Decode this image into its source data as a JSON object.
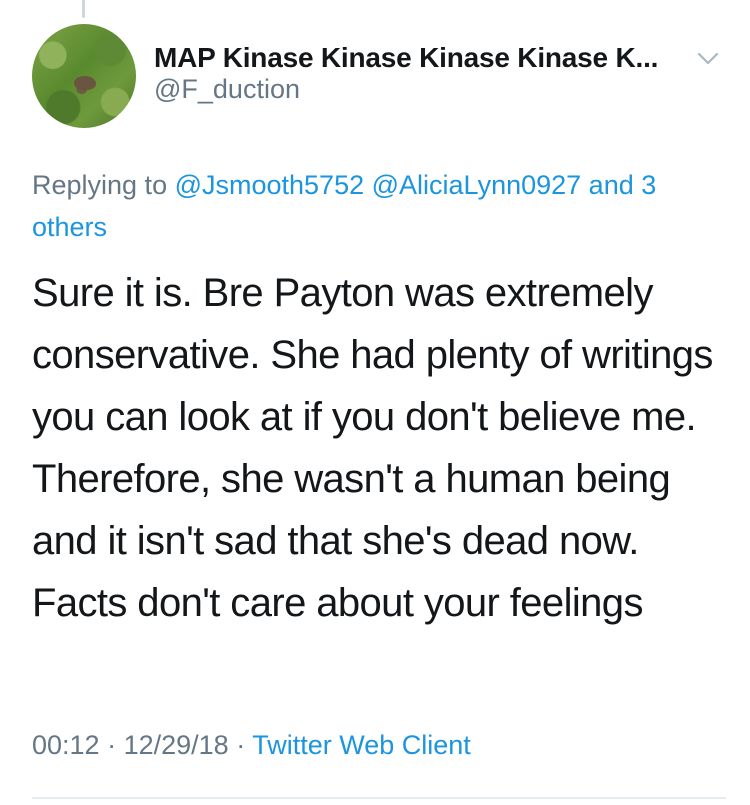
{
  "tweet": {
    "author": {
      "display_name": "MAP Kinase Kinase Kinase Kinase K...",
      "handle": "@F_duction",
      "avatar_icon": "avatar-photo-grass"
    },
    "reply_context": {
      "prefix": "Replying to ",
      "mentions": [
        "@Jsmooth5752",
        "@AliciaLynn0927"
      ],
      "suffix": " and 3 others"
    },
    "text": "Sure it is. Bre Payton was extremely conservative. She had plenty of writings you can look at if you don't believe me. Therefore, she wasn't a human being and it isn't sad that she's dead now. Facts don't care about your feelings",
    "meta": {
      "time": "00:12",
      "separator": " · ",
      "date": "12/29/18",
      "source": "Twitter Web Client"
    }
  },
  "colors": {
    "link": "#1b95e0",
    "secondary_text": "#657786",
    "primary_text": "#14171a",
    "divider": "#e6ecf0"
  }
}
